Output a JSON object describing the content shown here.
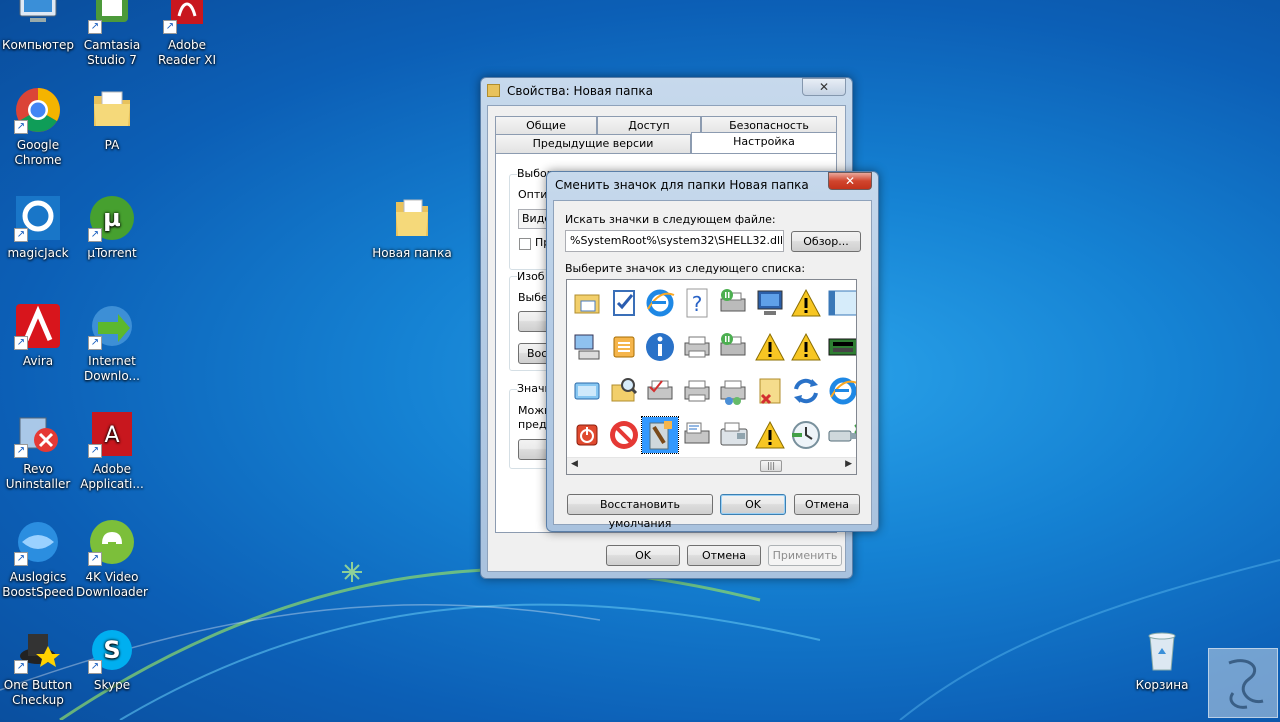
{
  "desktop": {
    "icons": [
      {
        "label": "Компьютер",
        "icon": "computer-icon"
      },
      {
        "label": "Camtasia Studio 7",
        "icon": "camtasia-icon"
      },
      {
        "label": "Adobe Reader XI",
        "icon": "adobe-reader-icon"
      },
      {
        "label": "Google Chrome",
        "icon": "chrome-icon"
      },
      {
        "label": "PA",
        "icon": "folder-icon"
      },
      {
        "label": "magicJack",
        "icon": "magicjack-icon"
      },
      {
        "label": "µTorrent",
        "icon": "utorrent-icon"
      },
      {
        "label": "Новая папка",
        "icon": "folder-icon"
      },
      {
        "label": "Avira",
        "icon": "avira-icon"
      },
      {
        "label": "Internet Downlo...",
        "icon": "idm-icon"
      },
      {
        "label": "Revo Uninstaller",
        "icon": "revo-icon"
      },
      {
        "label": "Adobe Applicati...",
        "icon": "adobe-icon"
      },
      {
        "label": "Auslogics BoostSpeed",
        "icon": "auslogics-icon"
      },
      {
        "label": "4K Video Downloader",
        "icon": "4k-video-icon"
      },
      {
        "label": "One Button Checkup",
        "icon": "checkup-icon"
      },
      {
        "label": "Skype",
        "icon": "skype-icon"
      },
      {
        "label": "Корзина",
        "icon": "recycle-bin-icon"
      }
    ]
  },
  "props_window": {
    "title": "Свойства: Новая папка",
    "tabs_row1": [
      "Общие",
      "Доступ",
      "Безопасность"
    ],
    "tabs_row2": [
      "Предыдущие версии",
      "Настройка"
    ],
    "active_tab": "Настройка",
    "group1_label": "Выбор основного типа папки",
    "opt_label": "Оптим",
    "select_value": "Виде",
    "checkbox_label": "Пр",
    "group2_label": "Изоб",
    "choose_label": "Выбер",
    "restore_btn": "Восс",
    "group3_label": "Значк",
    "can_label": "Можн",
    "can_label2": "предь",
    "ok": "OK",
    "cancel": "Отмена",
    "apply": "Применить"
  },
  "change_icon_dialog": {
    "title": "Сменить значок для папки Новая папка",
    "search_label": "Искать значки в следующем файле:",
    "file_path": "%SystemRoot%\\system32\\SHELL32.dll",
    "browse": "Обзор...",
    "list_label": "Выберите значок из следующего списка:",
    "restore_defaults": "Восстановить умолчания",
    "ok": "OK",
    "cancel": "Отмена",
    "icons": [
      [
        "calendar-folder-icon",
        "checklist-icon",
        "internet-explorer-icon",
        "help-icon",
        "printer-network-icon",
        "computer-monitor-icon",
        "warning-icon",
        "window-icon"
      ],
      [
        "network-computer-icon",
        "stack-icon",
        "info-icon",
        "printer-icon",
        "printer-network-icon",
        "warning-icon",
        "warning-icon",
        "network-cards-icon"
      ],
      [
        "display-icon",
        "search-folder-icon",
        "printer-check-icon",
        "printer-icon",
        "printer-share-icon",
        "folder-delete-icon",
        "refresh-icon",
        "internet-explorer-icon"
      ],
      [
        "power-icon",
        "no-entry-icon",
        "paint-icon",
        "fax-printer-icon",
        "fax-icon",
        "warning-icon",
        "clock-icon",
        "usb-icon"
      ]
    ]
  }
}
